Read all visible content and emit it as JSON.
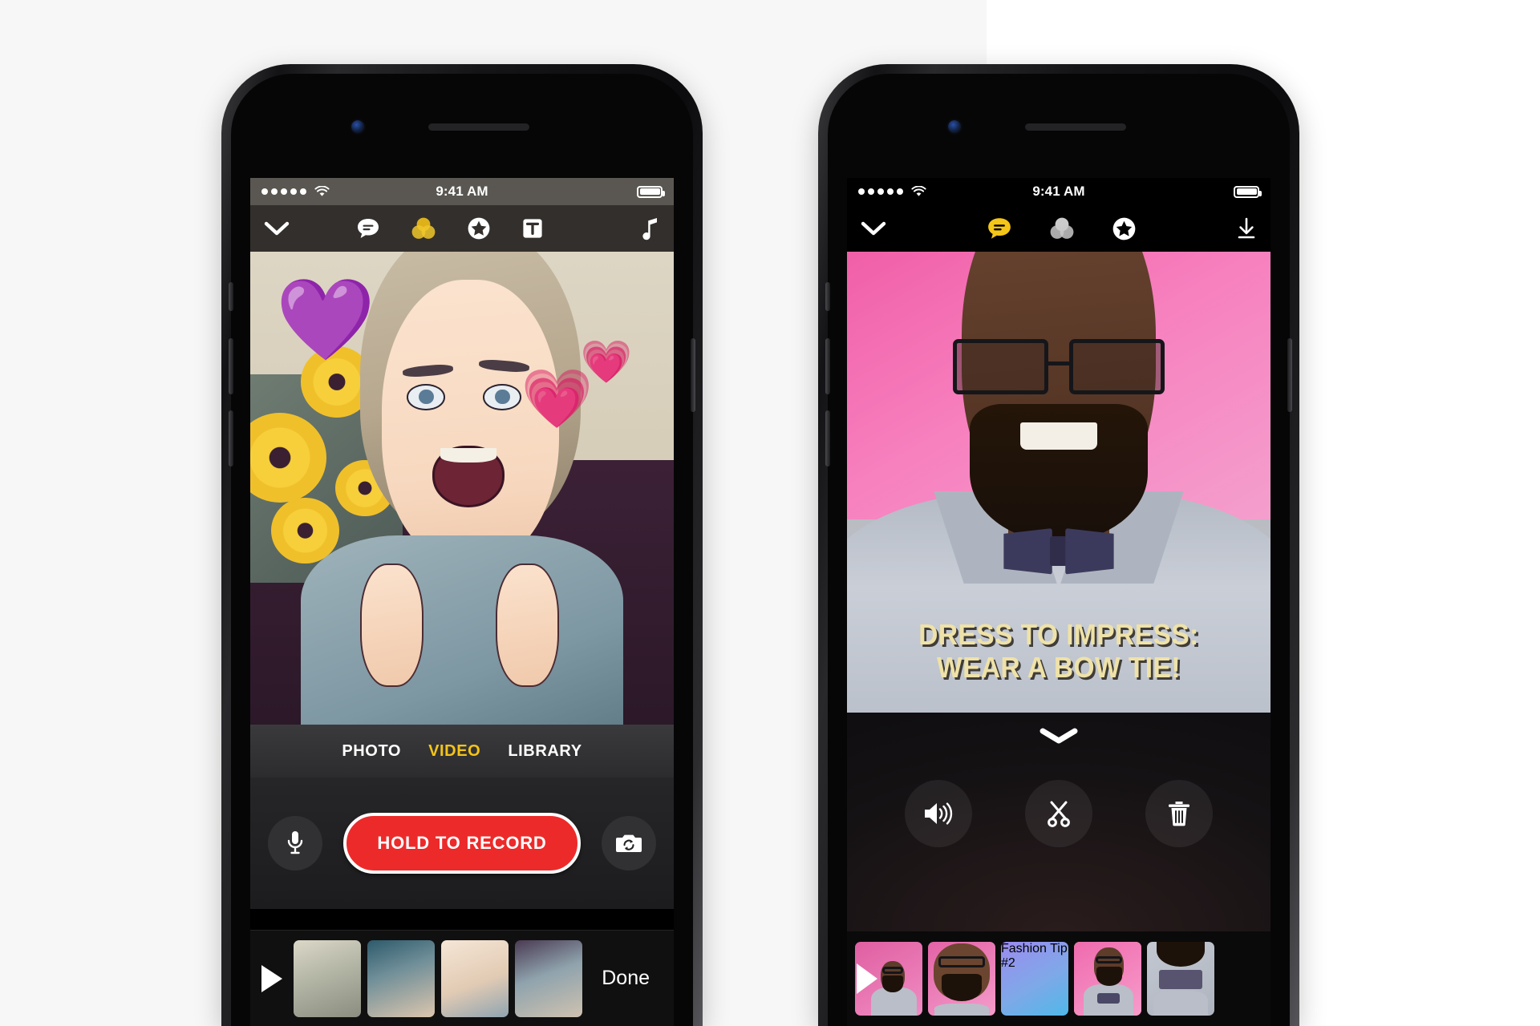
{
  "page": {
    "title": "Clips app — record and edit screens",
    "background": "#ffffff",
    "panel_background": "#f7f7f7"
  },
  "colors": {
    "accent_yellow": "#f5c518",
    "record_red": "#ed2a2a",
    "caption_cream": "#efe2a8",
    "toolbar_gray": "#332f2c",
    "statusbar_gray": "#5a5752"
  },
  "phone_left": {
    "name": "record-screen",
    "status_bar": {
      "signal_dots": 5,
      "wifi_icon": "wifi-icon",
      "time": "9:41 AM",
      "battery_icon": "battery-full-icon"
    },
    "toolbar": {
      "dismiss": {
        "icon": "chevron-down-icon",
        "label": "Close"
      },
      "items": [
        {
          "icon": "speech-bubble-icon",
          "label": "Live Titles",
          "active": false
        },
        {
          "icon": "filters-circles-icon",
          "label": "Filters",
          "active": true
        },
        {
          "icon": "star-badge-icon",
          "label": "Stickers",
          "active": false
        },
        {
          "icon": "text-t-icon",
          "label": "Text Posters",
          "active": false
        }
      ],
      "music": {
        "icon": "music-note-icon",
        "label": "Music"
      }
    },
    "preview": {
      "alt": "Comic-filter selfie of a woman giving two thumbs up in front of sunflowers",
      "stickers": [
        {
          "icon": "purple-heart-emoji",
          "glyph": "💜"
        },
        {
          "icon": "pink-heart-emoji",
          "glyph": "💗"
        },
        {
          "icon": "pink-heart-emoji",
          "glyph": "💗"
        }
      ]
    },
    "modes": [
      {
        "label": "PHOTO",
        "active": false
      },
      {
        "label": "VIDEO",
        "active": true
      },
      {
        "label": "LIBRARY",
        "active": false
      }
    ],
    "controls": {
      "mic": {
        "icon": "microphone-icon",
        "label": "Mic"
      },
      "record_label": "HOLD TO RECORD",
      "flip": {
        "icon": "camera-flip-icon",
        "label": "Flip camera"
      }
    },
    "filmstrip": {
      "play": {
        "icon": "play-triangle-icon",
        "label": "Play"
      },
      "clips": [
        {
          "label": "",
          "selected": false,
          "kind": "street"
        },
        {
          "label": "",
          "selected": false,
          "kind": "two-friends"
        },
        {
          "label": "",
          "selected": false,
          "kind": "portrait"
        },
        {
          "label": "",
          "selected": false,
          "kind": "room"
        }
      ],
      "done_label": "Done"
    }
  },
  "phone_right": {
    "name": "edit-screen",
    "status_bar": {
      "signal_dots": 5,
      "wifi_icon": "wifi-icon",
      "time": "9:41 AM",
      "battery_icon": "battery-full-icon"
    },
    "toolbar": {
      "dismiss": {
        "icon": "chevron-down-icon",
        "label": "Close"
      },
      "items": [
        {
          "icon": "speech-bubble-icon",
          "label": "Live Titles",
          "active": true
        },
        {
          "icon": "filters-circles-icon",
          "label": "Filters",
          "active": false
        },
        {
          "icon": "star-badge-icon",
          "label": "Stickers",
          "active": false
        }
      ],
      "share": {
        "icon": "download-arrow-icon",
        "label": "Save"
      }
    },
    "preview": {
      "alt": "Smiling bearded man with glasses and a bow tie on a pink background",
      "caption_line1": "DRESS TO IMPRESS:",
      "caption_line2": "WEAR A BOW TIE!"
    },
    "edit_panel": {
      "collapse": {
        "icon": "chevron-down-icon",
        "label": "Collapse"
      },
      "actions": [
        {
          "icon": "speaker-volume-icon",
          "label": "Volume"
        },
        {
          "icon": "scissors-icon",
          "label": "Split"
        },
        {
          "icon": "trash-icon",
          "label": "Delete"
        }
      ]
    },
    "filmstrip": {
      "play": {
        "icon": "play-triangle-icon",
        "label": "Play"
      },
      "clips": [
        {
          "label": "",
          "selected": false,
          "kind": "man-wide"
        },
        {
          "label": "",
          "selected": false,
          "kind": "man-close"
        },
        {
          "label": "Fashion Tip #2",
          "selected": false,
          "kind": "title-card"
        },
        {
          "label": "",
          "selected": true,
          "kind": "man-smile"
        },
        {
          "label": "",
          "selected": false,
          "kind": "bowtie"
        }
      ]
    }
  }
}
